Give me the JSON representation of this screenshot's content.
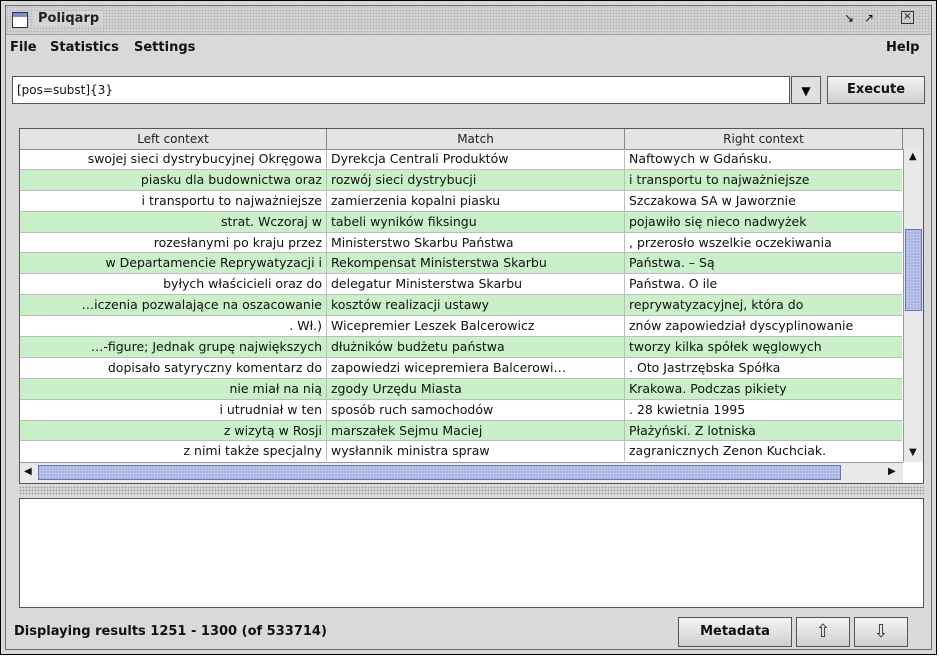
{
  "window": {
    "title": "Poliqarp",
    "controls": [
      "minimize-icon",
      "maximize-icon",
      "close-icon"
    ]
  },
  "menu": {
    "file": "File",
    "statistics": "Statistics",
    "settings": "Settings",
    "help": "Help"
  },
  "query": {
    "value": "[pos=subst]{3}",
    "dropdown_icon": "chevron-down-icon",
    "execute_label": "Execute"
  },
  "table": {
    "headers": {
      "left": "Left context",
      "match": "Match",
      "right": "Right context"
    },
    "rows": [
      {
        "left": "swojej sieci dystrybucyjnej Okręgowa",
        "match": "Dyrekcja Centrali Produktów",
        "right": "Naftowych w Gdańsku."
      },
      {
        "left": "piasku dla budownictwa oraz",
        "match": "rozwój sieci dystrybucji",
        "right": "i transportu to najważniejsze"
      },
      {
        "left": "i transportu to najważniejsze",
        "match": "zamierzenia kopalni piasku",
        "right": "Szczakowa SA w Jaworznie"
      },
      {
        "left": "strat. Wczoraj w",
        "match": "tabeli wyników fiksingu",
        "right": "pojawiło się nieco nadwyżek"
      },
      {
        "left": "rozesłanymi po kraju przez",
        "match": "Ministerstwo Skarbu Państwa",
        "right": ", przerosło wszelkie oczekiwania"
      },
      {
        "left": "w Departamencie Reprywatyzacji i",
        "match": "Rekompensat Ministerstwa Skarbu",
        "right": "Państwa. – Są"
      },
      {
        "left": "byłych właścicieli oraz do",
        "match": "delegatur Ministerstwa Skarbu",
        "right": "Państwa. O ile"
      },
      {
        "left": "…iczenia pozwalające na oszacowanie",
        "match": "kosztów realizacji ustawy",
        "right": "reprywatyzacyjnej, która do"
      },
      {
        "left": ". Wł.)",
        "match": "Wicepremier Leszek Balcerowicz",
        "right": "znów zapowiedział dyscyplinowanie"
      },
      {
        "left": "…-figure; Jednak grupę największych",
        "match": "dłużników budżetu państwa",
        "right": "tworzy kilka spółek węglowych"
      },
      {
        "left": "dopisało satyryczny komentarz do",
        "match": "zapowiedzi wicepremiera Balcerowi…",
        "right": ". Oto Jastrzębska Spółka"
      },
      {
        "left": "nie miał na nią",
        "match": "zgody Urzędu Miasta",
        "right": "Krakowa. Podczas pikiety"
      },
      {
        "left": "i utrudniał w ten",
        "match": "sposób ruch samochodów",
        "right": ". 28 kwietnia 1995"
      },
      {
        "left": "z wizytą w Rosji",
        "match": "marszałek Sejmu Maciej",
        "right": "Płażyński. Z lotniska"
      },
      {
        "left": "z nimi także specjalny",
        "match": "wysłannik ministra spraw",
        "right": "zagranicznych Zenon Kuchciak."
      }
    ]
  },
  "status": {
    "text": "Displaying results 1251 - 1300 (of 533714)",
    "metadata_label": "Metadata",
    "prev_icon": "arrow-up-icon",
    "next_icon": "arrow-down-icon"
  },
  "colors": {
    "row_highlight": "#c9f0c9",
    "scroll_thumb": "#a9b1e1"
  }
}
